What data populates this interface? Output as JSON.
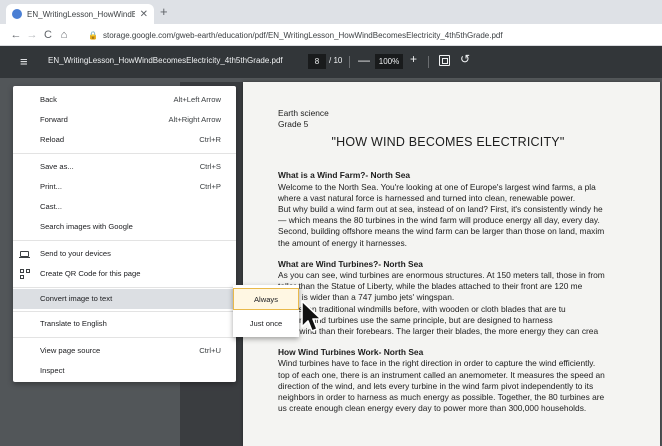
{
  "browser": {
    "tab_title": "EN_WritingLesson_HowWindBec",
    "tab_close": "✕",
    "new_tab": "+",
    "nav_back": "←",
    "nav_forward": "→",
    "nav_reload": "C",
    "nav_home": "⌂",
    "url": "storage.googleapis.com/gweb-earth/education/pdf/EN_WritingLesson_HowWindBecomesElectricity_4th5thGrade.pdf",
    "url_display": "storage.google.com/gweb-earth/education/pdf/EN_WritingLesson_HowWindBecomesElectricity_4th5thGrade.pdf"
  },
  "pdf_viewer": {
    "menu_glyph": "≡",
    "file_title": "EN_WritingLesson_HowWindBecomesElectricity_4th5thGrade.pdf",
    "current_page": "8",
    "page_total": "/ 10",
    "zoom_minus": "—",
    "zoom": "100%",
    "zoom_plus": "+",
    "rotate_glyph": "↺"
  },
  "document": {
    "subject": "Earth science",
    "grade": "Grade 5",
    "title": "\"HOW WIND BECOMES ELECTRICITY\"",
    "sections": [
      {
        "heading": "What is a Wind Farm?- North Sea",
        "lines": [
          "Welcome to the North Sea. You're looking at one of Europe's largest wind farms, a pla",
          "where a vast natural force is harnessed and turned into clean, renewable power.",
          "But why build a wind farm out at sea, instead of on land? First, it's consistently windy he",
          "— which means the 80 turbines in the wind farm will produce energy all day, every day.",
          "Second, building offshore means the wind farm can be larger than those on land, maxim",
          "the amount of energy it harnesses."
        ]
      },
      {
        "heading": "What are Wind Turbines?- North Sea",
        "lines": [
          "As you can see, wind turbines are enormous structures. At 150 meters tall, those in from",
          "taller than the Statue of Liberty, while the blades attached to their front are 120 me",
          "which is wider than a 747 jumbo jets' wingspan.",
          "have seen traditional windmills before, with wooden or cloth blades that are tu",
          "Modern wind turbines use the same principle, but are designed to harness",
          "more wind than their forebears. The larger their blades, the more energy they can crea"
        ]
      },
      {
        "heading": "How Wind Turbines Work- North Sea",
        "lines": [
          "Wind turbines have to face in the right direction in order to capture the wind efficiently.",
          "top of each one, there is an instrument called an anemometer. It measures the speed an",
          "direction of the wind, and lets every turbine in the wind farm pivot independently to its",
          "neighbors in order to harness as much energy as possible. Together, the 80 turbines are",
          "us create enough clean energy every day to power more than 300,000 households."
        ]
      }
    ]
  },
  "context_menu": {
    "items": [
      {
        "label": "Back",
        "shortcut": "Alt+Left Arrow"
      },
      {
        "label": "Forward",
        "shortcut": "Alt+Right Arrow"
      },
      {
        "label": "Reload",
        "shortcut": "Ctrl+R"
      },
      {
        "label": "Save as...",
        "shortcut": "Ctrl+S"
      },
      {
        "label": "Print...",
        "shortcut": "Ctrl+P"
      },
      {
        "label": "Cast..."
      },
      {
        "label": "Search images with Google"
      },
      {
        "label": "Send to your devices",
        "icon": "laptop-icon"
      },
      {
        "label": "Create QR Code for this page",
        "icon": "qr-code-icon"
      },
      {
        "label": "Convert image to text",
        "state": "highlighted"
      },
      {
        "label": "Translate to English"
      },
      {
        "label": "View page source",
        "shortcut": "Ctrl+U"
      },
      {
        "label": "Inspect"
      }
    ],
    "submenu": {
      "items": [
        {
          "label": "Always",
          "state": "highlighted"
        },
        {
          "label": "Just once"
        }
      ]
    }
  },
  "colors": {
    "pdf_toolbar": "#323639",
    "viewer_background": "#525659",
    "menu_highlight": "#dcdfe3",
    "submenu_highlight_border": "#e9b94a"
  }
}
